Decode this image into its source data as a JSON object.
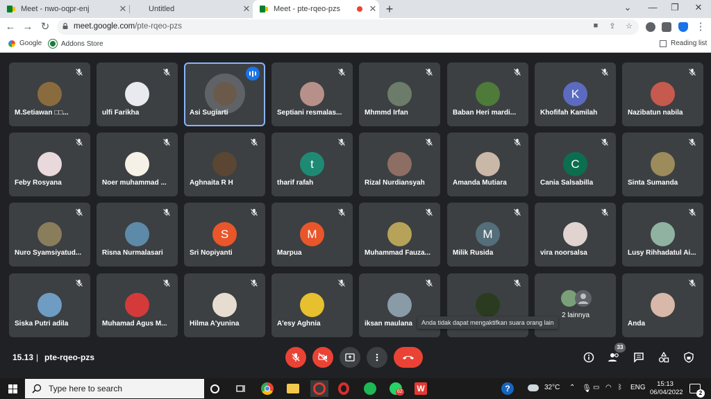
{
  "browser": {
    "tabs": [
      {
        "title": "Meet - nwo-oqpr-enj",
        "close": "✕"
      },
      {
        "title": "Untitled",
        "close": "✕"
      },
      {
        "title": "Meet - pte-rqeo-pzs",
        "close": "✕"
      }
    ],
    "new_tab": "+",
    "window_controls": {
      "dropdown": "⌄",
      "minimize": "—",
      "maximize": "❐",
      "close": "✕"
    },
    "nav": {
      "back": "←",
      "forward": "→",
      "reload": "↻"
    },
    "url_host": "meet.google.com",
    "url_path": "/pte-rqeo-pzs",
    "bookmarks": [
      {
        "label": "Google"
      },
      {
        "label": "Addons Store"
      }
    ],
    "reading_list": "Reading list"
  },
  "meet": {
    "participants": [
      {
        "name": "M.Setiawan □□...",
        "avatar_color": "#8a6b3e"
      },
      {
        "name": "ulfi Farikha",
        "avatar_color": "#e8eaf0"
      },
      {
        "name": "Asi Sugiarti",
        "avatar_color": "#6b5a4a",
        "speaking": true
      },
      {
        "name": "Septiani resmalas...",
        "avatar_color": "#b8908a"
      },
      {
        "name": "Mhmmd Irfan",
        "avatar_color": "#6d7c6a"
      },
      {
        "name": "Baban Heri mardi...",
        "avatar_color": "#4e7a3a"
      },
      {
        "name": "Khofifah Kamilah",
        "avatar_color": "#5c6bc0",
        "initial": "K"
      },
      {
        "name": "Nazibatun nabila",
        "avatar_color": "#c65a4f"
      },
      {
        "name": "Feby Rosyana",
        "avatar_color": "#e9d8dc"
      },
      {
        "name": "Noer muhammad ...",
        "avatar_color": "#f5f1e6"
      },
      {
        "name": "Aghnaita R H",
        "avatar_color": "#5a4632"
      },
      {
        "name": "tharif rafah",
        "avatar_color": "#1e8a74",
        "initial": "t"
      },
      {
        "name": "Rizal Nurdiansyah",
        "avatar_color": "#8d6e63"
      },
      {
        "name": "Amanda Mutiara",
        "avatar_color": "#c9b7a8"
      },
      {
        "name": "Cania Salsabilla",
        "avatar_color": "#0b6e4f",
        "initial": "C"
      },
      {
        "name": "Sinta Sumanda",
        "avatar_color": "#9c8b5b"
      },
      {
        "name": "Nuro Syamsiyatud...",
        "avatar_color": "#8a7d5c"
      },
      {
        "name": "Risna Nurmalasari",
        "avatar_color": "#5d8aa8"
      },
      {
        "name": "Sri Nopiyanti",
        "avatar_color": "#e8562a",
        "initial": "S"
      },
      {
        "name": "Marpua",
        "avatar_color": "#e8562a",
        "initial": "M"
      },
      {
        "name": "Muhammad Fauza...",
        "avatar_color": "#b7a25a"
      },
      {
        "name": "Milik Rusida",
        "avatar_color": "#546e7a",
        "initial": "M"
      },
      {
        "name": "vira noorsalsa",
        "avatar_color": "#e0d3d0"
      },
      {
        "name": "Lusy Rihhadatul Ai...",
        "avatar_color": "#8fb3a0"
      },
      {
        "name": "Siska Putri adila",
        "avatar_color": "#6f9cc2"
      },
      {
        "name": "Muhamad Agus M...",
        "avatar_color": "#d43a3a"
      },
      {
        "name": "Hilma A'yunina",
        "avatar_color": "#e6ddd0"
      },
      {
        "name": "A'esy Aghnia",
        "avatar_color": "#e6c02e"
      },
      {
        "name": "iksan maulana",
        "avatar_color": "#8a9ba8"
      },
      {
        "name": "",
        "avatar_color": "#2b3b1f"
      },
      {
        "name": "2 lainnya",
        "avatar_color": "#7aa07a",
        "others": true
      },
      {
        "name": "Anda",
        "avatar_color": "#d8b8a8"
      }
    ],
    "tooltip": "Anda tidak dapat mengaktifkan suara orang lain",
    "time": "15.13",
    "separator": "|",
    "meeting_code": "pte-rqeo-pzs",
    "participant_count": "33",
    "colors": {
      "danger": "#ea4335",
      "tile": "#3c4043",
      "background": "#202124",
      "accent": "#1a73e8"
    }
  },
  "taskbar": {
    "search_placeholder": "Type here to search",
    "weather": "32°C",
    "language": "ENG",
    "time": "15:13",
    "date": "06/04/2022",
    "notifications": "2",
    "whatsapp_badge": "62"
  }
}
